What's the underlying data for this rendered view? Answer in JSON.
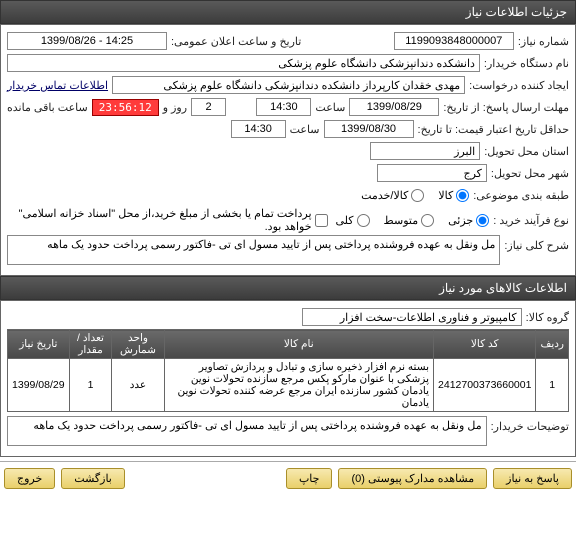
{
  "header": {
    "title": "جزئیات اطلاعات نیاز"
  },
  "form": {
    "need_no_label": "شماره نیاز:",
    "need_no": "1199093848000007",
    "announce_label": "تاریخ و ساعت اعلان عمومی:",
    "announce_value": "1399/08/26 - 14:25",
    "buyer_label": "نام دستگاه خریدار:",
    "buyer_value": "دانشکده دندانپزشکی دانشگاه علوم پزشکی",
    "creator_label": "ایجاد کننده درخواست:",
    "creator_value": "مهدی خقدان کارپرداز دانشکده دندانپزشکی دانشگاه علوم پزشکی",
    "contact_link": "اطلاعات تماس خریدار",
    "deadline_label": "مهلت ارسال پاسخ: از تاریخ:",
    "deadline_date": "1399/08/29",
    "time_label": "ساعت",
    "deadline_time": "14:30",
    "days_remain": "2",
    "days_remain_label": "روز و",
    "countdown": "23:56:12",
    "countdown_label": "ساعت باقی مانده",
    "validity_label": "حداقل تاریخ اعتبار قیمت: تا تاریخ:",
    "validity_date": "1399/08/30",
    "validity_time": "14:30",
    "province_label": "استان محل تحویل:",
    "province_value": "البرز",
    "city_label": "شهر محل تحویل:",
    "city_value": "کرج",
    "budget_label": "طبقه بندی موضوعی:",
    "budget_opts": {
      "goods": "کالا",
      "service": "کالا/خدمت"
    },
    "process_label": "نوع فرآیند خرید :",
    "process_opts": {
      "small": "جزئی",
      "medium": "متوسط",
      "large": "کلی"
    },
    "note": "پرداخت تمام یا بخشی از مبلغ خرید،از محل \"اسناد خزانه اسلامی\" خواهد بود.",
    "desc_label": "شرح کلی نیاز:",
    "desc_value": "مل ونقل به عهده فروشنده پرداختی پس از تایید مسول ای تی -فاکتور رسمی پرداخت حدود یک ماهه"
  },
  "items_header": {
    "title": "اطلاعات کالاهای مورد نیاز"
  },
  "group": {
    "label": "گروه کالا:",
    "value": "کامپیوتر و فناوری اطلاعات-سخت افزار"
  },
  "table": {
    "cols": {
      "row": "ردیف",
      "code": "کد کالا",
      "name": "نام کالا",
      "unit": "واحد شمارش",
      "qty": "تعداد / مقدار",
      "date": "تاریخ نیاز"
    },
    "rows": [
      {
        "idx": "1",
        "code": "2412700373660001",
        "name": "بسته نرم افزار ذخیره سازی و تبادل و پردازش تصاویر پزشکی با عنوان مارکو پکس مرجع سازنده تحولات نوین یادمان کشور سازنده ایران مرجع عرضه کننده تحولات نوین یادمان",
        "unit": "عدد",
        "qty": "1",
        "date": "1399/08/29"
      }
    ]
  },
  "buyer_notes": {
    "label": "توضیحات خریدار:",
    "value": "مل ونقل به عهده فروشنده پرداختی پس از تایید مسول ای تی -فاکتور رسمی پرداخت حدود یک ماهه"
  },
  "buttons": {
    "reply": "پاسخ به نیاز",
    "attachments": "مشاهده مدارک پیوستی (0)",
    "print": "چاپ",
    "back": "بازگشت",
    "exit": "خروج"
  }
}
